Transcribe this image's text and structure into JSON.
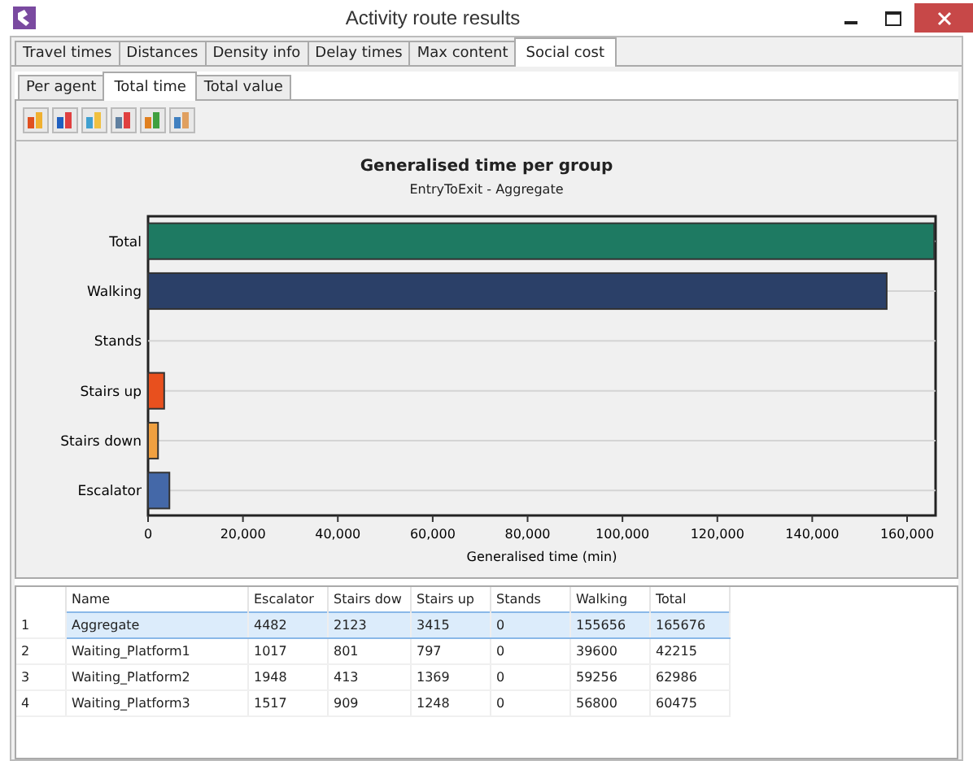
{
  "window": {
    "title": "Activity route results"
  },
  "tabs": [
    {
      "label": "Travel times",
      "selected": false
    },
    {
      "label": "Distances",
      "selected": false
    },
    {
      "label": "Density info",
      "selected": false
    },
    {
      "label": "Delay times",
      "selected": false
    },
    {
      "label": "Max content",
      "selected": false
    },
    {
      "label": "Social cost",
      "selected": true
    }
  ],
  "subtabs": [
    {
      "label": "Per agent",
      "selected": false
    },
    {
      "label": "Total time",
      "selected": true
    },
    {
      "label": "Total value",
      "selected": false
    }
  ],
  "chart": {
    "chart_data": {
      "type": "bar",
      "orientation": "horizontal",
      "title": "Generalised time per group",
      "subtitle": "EntryToExit - Aggregate",
      "xlabel": "Generalised time (min)",
      "categories": [
        "Total",
        "Walking",
        "Stands",
        "Stairs up",
        "Stairs down",
        "Escalator"
      ],
      "values": [
        165700,
        155700,
        0,
        3400,
        2100,
        4500
      ],
      "xlim": [
        0,
        166000
      ],
      "xticks": [
        {
          "value": 0,
          "label": "0"
        },
        {
          "value": 20000,
          "label": "20,000"
        },
        {
          "value": 40000,
          "label": "40,000"
        },
        {
          "value": 60000,
          "label": "60,000"
        },
        {
          "value": 80000,
          "label": "80,000"
        },
        {
          "value": 100000,
          "label": "100,000"
        },
        {
          "value": 120000,
          "label": "120,000"
        },
        {
          "value": 140000,
          "label": "140,000"
        },
        {
          "value": 160000,
          "label": "160,000"
        }
      ]
    }
  },
  "table": {
    "columns": [
      "Name",
      "Escalator",
      "Stairs dow",
      "Stairs up",
      "Stands",
      "Walking",
      "Total"
    ],
    "rows": [
      {
        "index": "1",
        "cells": [
          "Aggregate",
          "4482",
          "2123",
          "3415",
          "0",
          "155656",
          "165676"
        ],
        "selected": true
      },
      {
        "index": "2",
        "cells": [
          "Waiting_Platform1",
          "1017",
          "801",
          "797",
          "0",
          "39600",
          "42215"
        ],
        "selected": false
      },
      {
        "index": "3",
        "cells": [
          "Waiting_Platform2",
          "1948",
          "413",
          "1369",
          "0",
          "59256",
          "62986"
        ],
        "selected": false
      },
      {
        "index": "4",
        "cells": [
          "Waiting_Platform3",
          "1517",
          "909",
          "1248",
          "0",
          "56800",
          "60475"
        ],
        "selected": false
      }
    ]
  }
}
